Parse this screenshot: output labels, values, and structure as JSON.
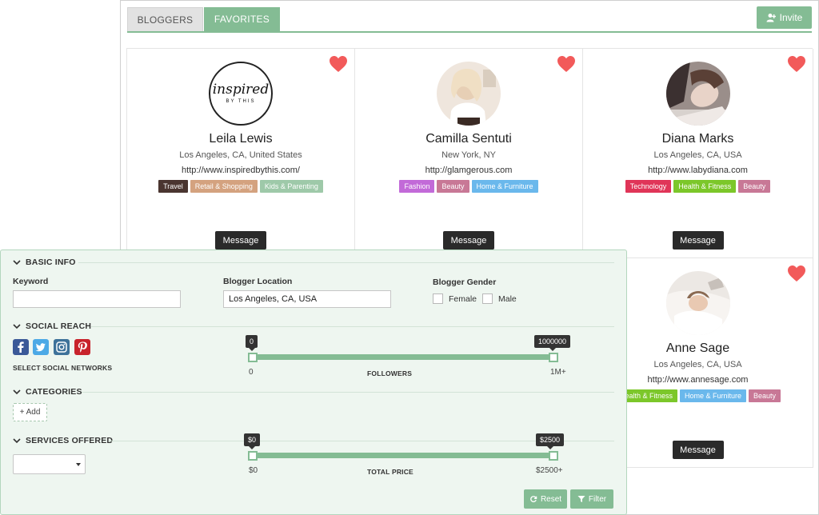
{
  "tabs": {
    "bloggers": "BLOGGERS",
    "favorites": "FAVORITES"
  },
  "invite_label": "Invite",
  "cards": [
    {
      "name": "Leila Lewis",
      "location": "Los Angeles, CA, United States",
      "url": "http://www.inspiredbythis.com/",
      "logo_text": "inspired",
      "logo_sub": "BY THIS",
      "tags": [
        {
          "label": "Travel",
          "color": "#4a3530"
        },
        {
          "label": "Retail & Shopping",
          "color": "#d4a27f"
        },
        {
          "label": "Kids & Parenting",
          "color": "#9ec9a9"
        }
      ],
      "message": "Message"
    },
    {
      "name": "Camilla Sentuti",
      "location": "New York, NY",
      "url": "http://glamgerous.com",
      "tags": [
        {
          "label": "Fashion",
          "color": "#c26ad8"
        },
        {
          "label": "Beauty",
          "color": "#c87896"
        },
        {
          "label": "Home & Furniture",
          "color": "#6ab8ec"
        }
      ],
      "message": "Message"
    },
    {
      "name": "Diana Marks",
      "location": "Los Angeles, CA, USA",
      "url": "http://www.labydiana.com",
      "tags": [
        {
          "label": "Technology",
          "color": "#e03558"
        },
        {
          "label": "Health & Fitness",
          "color": "#7cc72a"
        },
        {
          "label": "Beauty",
          "color": "#c87896"
        }
      ],
      "message": "Message"
    },
    {
      "name": "Anne Sage",
      "location": "Los Angeles, CA, USA",
      "url": "http://www.annesage.com",
      "tags": [
        {
          "label": "Health & Fitness",
          "color": "#7cc72a"
        },
        {
          "label": "Home & Furniture",
          "color": "#6ab8ec"
        },
        {
          "label": "Beauty",
          "color": "#c87896"
        }
      ],
      "message": "Message"
    }
  ],
  "filters": {
    "basic_info": "BASIC INFO",
    "keyword_label": "Keyword",
    "keyword_value": "",
    "location_label": "Blogger Location",
    "location_value": "Los Angeles, CA, USA",
    "gender_label": "Blogger Gender",
    "female": "Female",
    "male": "Male",
    "social_reach": "SOCIAL REACH",
    "select_networks": "SELECT SOCIAL NETWORKS",
    "followers": {
      "min_tip": "0",
      "max_tip": "1000000",
      "min_label": "0",
      "max_label": "1M+",
      "axis_label": "FOLLOWERS"
    },
    "categories": "CATEGORIES",
    "add_label": "+ Add",
    "services_offered": "SERVICES OFFERED",
    "price": {
      "min_tip": "$0",
      "max_tip": "$2500",
      "min_label": "$0",
      "max_label": "$2500+",
      "axis_label": "TOTAL PRICE"
    },
    "reset": "Reset",
    "filter": "Filter"
  },
  "colors": {
    "accent": "#84bc94",
    "heart": "#f25a5a",
    "dark_button": "#2a2a2a"
  }
}
